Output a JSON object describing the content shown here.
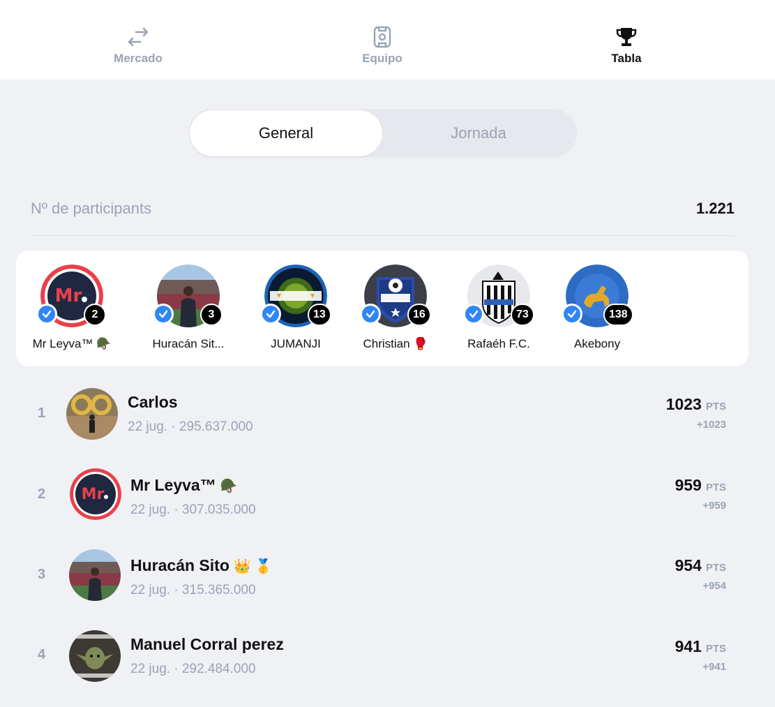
{
  "nav": {
    "items": [
      {
        "label": "Mercado",
        "icon": "swap-arrows-icon",
        "active": false
      },
      {
        "label": "Equipo",
        "icon": "jersey-card-icon",
        "active": false
      },
      {
        "label": "Tabla",
        "icon": "trophy-icon",
        "active": true
      }
    ]
  },
  "tabs": {
    "general": "General",
    "jornada": "Jornada",
    "selected": "General"
  },
  "participants": {
    "label": "Nº de participants",
    "value": "1.221"
  },
  "top_users": [
    {
      "name": "Mr Leyva™ 🪖",
      "position": "2",
      "avatar": "mr-logo"
    },
    {
      "name": "Huracán Sit...",
      "position": "3",
      "avatar": "stadium-photo"
    },
    {
      "name": "JUMANJI",
      "position": "13",
      "avatar": "jumanji-logo"
    },
    {
      "name": "Christian 🥊",
      "position": "16",
      "avatar": "super-ak-badge"
    },
    {
      "name": "Rafaéh F.C.",
      "position": "73",
      "avatar": "newcastle-crest"
    },
    {
      "name": "Akebony",
      "position": "138",
      "avatar": "liga-akebony-crest"
    }
  ],
  "standings": [
    {
      "rank": "1",
      "name": "Carlos",
      "emoji": "",
      "sub": "22 jug. · 295.637.000",
      "points": "1023",
      "unit": "PTS",
      "delta": "+1023"
    },
    {
      "rank": "2",
      "name": "Mr Leyva™",
      "emoji": "🪖",
      "sub": "22 jug. · 307.035.000",
      "points": "959",
      "unit": "PTS",
      "delta": "+959"
    },
    {
      "rank": "3",
      "name": "Huracán Sito",
      "emoji": "👑 🥇",
      "sub": "22 jug. · 315.365.000",
      "points": "954",
      "unit": "PTS",
      "delta": "+954"
    },
    {
      "rank": "4",
      "name": "Manuel Corral perez",
      "emoji": "",
      "sub": "22 jug. · 292.484.000",
      "points": "941",
      "unit": "PTS",
      "delta": "+941"
    }
  ],
  "colors": {
    "background": "#f0f1f5",
    "muted": "#9aa3b5",
    "verified": "#2f86f5",
    "brand_red": "#e8414a"
  }
}
